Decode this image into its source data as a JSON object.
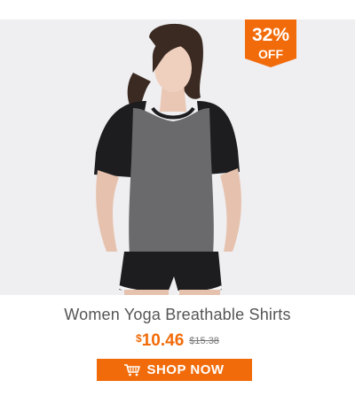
{
  "product": {
    "title": "Women Yoga Breathable Shirts",
    "currency": "$",
    "price": "10.46",
    "original_price": "$15.38",
    "image_alt": "Woman wearing grey yoga shirt with black sleeves and black shorts"
  },
  "badge": {
    "percent": "32%",
    "label": "OFF",
    "color": "#f26b0a"
  },
  "cta": {
    "label": "SHOP NOW",
    "icon": "shopping-cart-icon",
    "color": "#f26b0a"
  }
}
